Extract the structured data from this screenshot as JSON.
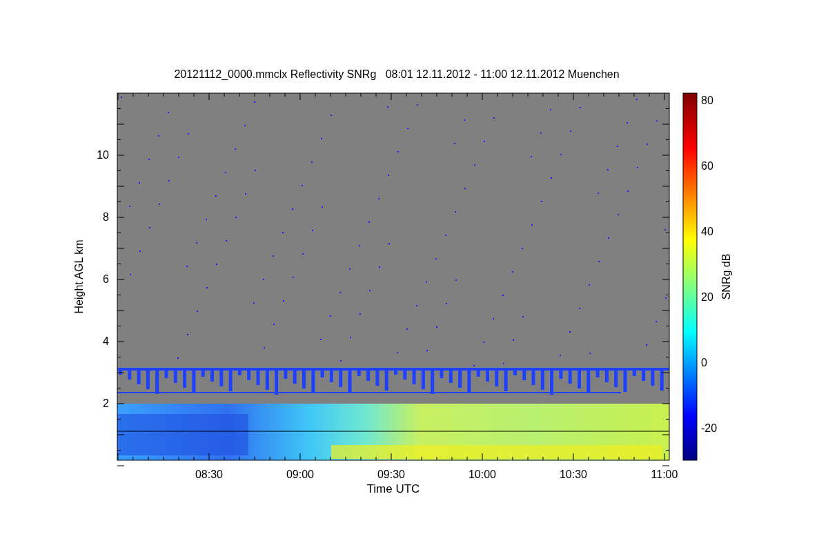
{
  "plot": {
    "title": "20121112_0000.mmclx Reflectivity SNRg   08:01 12.11.2012 - 11:00 12.11.2012 Muenchen",
    "ylabel": "Height AGL km",
    "xlabel": "Time UTC",
    "yticks": [
      "10",
      "8",
      "6",
      "4",
      "2"
    ],
    "xticks": [
      "08:30",
      "09:00",
      "09:30",
      "10:00",
      "10:30",
      "11:00"
    ]
  },
  "colorbar": {
    "label": "SNRg dB",
    "ticks": [
      "80",
      "60",
      "40",
      "20",
      "0",
      "-20"
    ]
  }
}
